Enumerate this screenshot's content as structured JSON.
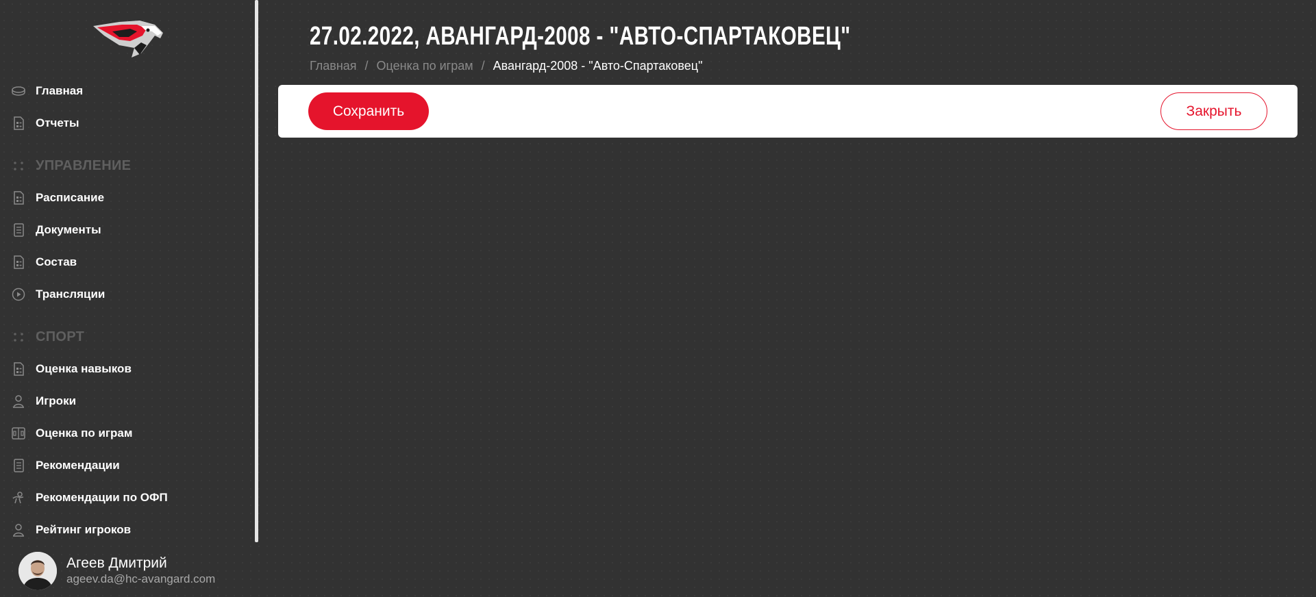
{
  "brand": {
    "logo_icon": "hawk-logo-icon",
    "accent_color": "#e5142c"
  },
  "sidebar": {
    "items": [
      {
        "label": "Главная",
        "icon": "puck-icon"
      },
      {
        "label": "Отчеты",
        "icon": "report-icon"
      },
      {
        "label": "УПРАВЛЕНИЕ",
        "icon": "section-dots-icon"
      },
      {
        "label": "Расписание",
        "icon": "schedule-icon"
      },
      {
        "label": "Документы",
        "icon": "document-icon"
      },
      {
        "label": "Состав",
        "icon": "roster-icon"
      },
      {
        "label": "Трансляции",
        "icon": "play-icon"
      },
      {
        "label": "СПОРТ",
        "icon": "section-dots-icon"
      },
      {
        "label": "Оценка навыков",
        "icon": "skills-icon"
      },
      {
        "label": "Игроки",
        "icon": "player-icon"
      },
      {
        "label": "Оценка по играм",
        "icon": "rink-icon"
      },
      {
        "label": "Рекомендации",
        "icon": "document-icon"
      },
      {
        "label": "Рекомендации по ОФП",
        "icon": "fitness-icon"
      },
      {
        "label": "Рейтинг игроков",
        "icon": "rating-icon"
      }
    ],
    "user": {
      "name": "Агеев Дмитрий",
      "email": "ageev.da@hc-avangard.com"
    }
  },
  "main": {
    "title": "27.02.2022, АВАНГАРД-2008 - \"АВТО-СПАРТАКОВЕЦ\"",
    "breadcrumb": {
      "home": "Главная",
      "section": "Оценка по играм",
      "current": "Авангард-2008 - \"Авто-Спартаковец\""
    },
    "toolbar": {
      "save_label": "Сохранить",
      "close_label": "Закрыть"
    }
  }
}
